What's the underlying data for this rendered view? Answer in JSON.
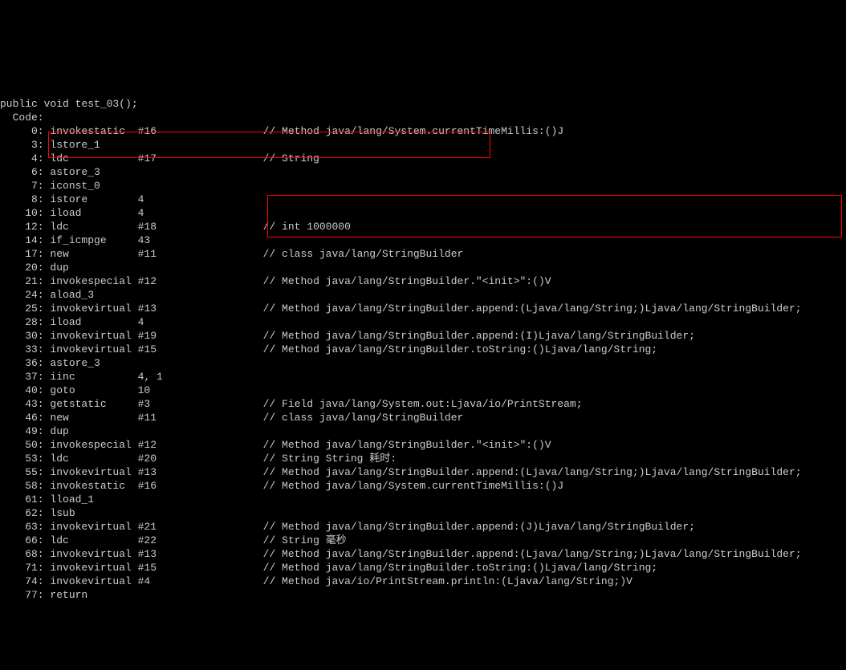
{
  "header": "public void test_03();",
  "code_label": "  Code:",
  "lines": [
    {
      "offset": " 0",
      "instr": "invokestatic",
      "arg": "#16",
      "comment": "// Method java/lang/System.currentTimeMillis:()J"
    },
    {
      "offset": " 3",
      "instr": "lstore_1",
      "arg": "",
      "comment": ""
    },
    {
      "offset": " 4",
      "instr": "ldc",
      "arg": "#17",
      "comment": "// String"
    },
    {
      "offset": " 6",
      "instr": "astore_3",
      "arg": "",
      "comment": ""
    },
    {
      "offset": " 7",
      "instr": "iconst_0",
      "arg": "",
      "comment": ""
    },
    {
      "offset": " 8",
      "instr": "istore",
      "arg": "4",
      "comment": ""
    },
    {
      "offset": "10",
      "instr": "iload",
      "arg": "4",
      "comment": ""
    },
    {
      "offset": "12",
      "instr": "ldc",
      "arg": "#18",
      "comment": "// int 1000000"
    },
    {
      "offset": "14",
      "instr": "if_icmpge",
      "arg": "43",
      "comment": ""
    },
    {
      "offset": "17",
      "instr": "new",
      "arg": "#11",
      "comment": "// class java/lang/StringBuilder"
    },
    {
      "offset": "20",
      "instr": "dup",
      "arg": "",
      "comment": ""
    },
    {
      "offset": "21",
      "instr": "invokespecial",
      "arg": "#12",
      "comment": "// Method java/lang/StringBuilder.\"<init>\":()V"
    },
    {
      "offset": "24",
      "instr": "aload_3",
      "arg": "",
      "comment": ""
    },
    {
      "offset": "25",
      "instr": "invokevirtual",
      "arg": "#13",
      "comment": "// Method java/lang/StringBuilder.append:(Ljava/lang/String;)Ljava/lang/StringBuilder;"
    },
    {
      "offset": "28",
      "instr": "iload",
      "arg": "4",
      "comment": ""
    },
    {
      "offset": "30",
      "instr": "invokevirtual",
      "arg": "#19",
      "comment": "// Method java/lang/StringBuilder.append:(I)Ljava/lang/StringBuilder;"
    },
    {
      "offset": "33",
      "instr": "invokevirtual",
      "arg": "#15",
      "comment": "// Method java/lang/StringBuilder.toString:()Ljava/lang/String;"
    },
    {
      "offset": "36",
      "instr": "astore_3",
      "arg": "",
      "comment": ""
    },
    {
      "offset": "37",
      "instr": "iinc",
      "arg": "4, 1",
      "comment": ""
    },
    {
      "offset": "40",
      "instr": "goto",
      "arg": "10",
      "comment": ""
    },
    {
      "offset": "43",
      "instr": "getstatic",
      "arg": "#3",
      "comment": "// Field java/lang/System.out:Ljava/io/PrintStream;"
    },
    {
      "offset": "46",
      "instr": "new",
      "arg": "#11",
      "comment": "// class java/lang/StringBuilder"
    },
    {
      "offset": "49",
      "instr": "dup",
      "arg": "",
      "comment": ""
    },
    {
      "offset": "50",
      "instr": "invokespecial",
      "arg": "#12",
      "comment": "// Method java/lang/StringBuilder.\"<init>\":()V"
    },
    {
      "offset": "53",
      "instr": "ldc",
      "arg": "#20",
      "comment": "// String String 耗时:"
    },
    {
      "offset": "55",
      "instr": "invokevirtual",
      "arg": "#13",
      "comment": "// Method java/lang/StringBuilder.append:(Ljava/lang/String;)Ljava/lang/StringBuilder;"
    },
    {
      "offset": "58",
      "instr": "invokestatic",
      "arg": "#16",
      "comment": "// Method java/lang/System.currentTimeMillis:()J"
    },
    {
      "offset": "61",
      "instr": "lload_1",
      "arg": "",
      "comment": ""
    },
    {
      "offset": "62",
      "instr": "lsub",
      "arg": "",
      "comment": ""
    },
    {
      "offset": "63",
      "instr": "invokevirtual",
      "arg": "#21",
      "comment": "// Method java/lang/StringBuilder.append:(J)Ljava/lang/StringBuilder;"
    },
    {
      "offset": "66",
      "instr": "ldc",
      "arg": "#22",
      "comment": "// String 毫秒"
    },
    {
      "offset": "68",
      "instr": "invokevirtual",
      "arg": "#13",
      "comment": "// Method java/lang/StringBuilder.append:(Ljava/lang/String;)Ljava/lang/StringBuilder;"
    },
    {
      "offset": "71",
      "instr": "invokevirtual",
      "arg": "#15",
      "comment": "// Method java/lang/StringBuilder.toString:()Ljava/lang/String;"
    },
    {
      "offset": "74",
      "instr": "invokevirtual",
      "arg": "#4",
      "comment": "// Method java/io/PrintStream.println:(Ljava/lang/String;)V"
    },
    {
      "offset": "77",
      "instr": "return",
      "arg": "",
      "comment": ""
    }
  ]
}
